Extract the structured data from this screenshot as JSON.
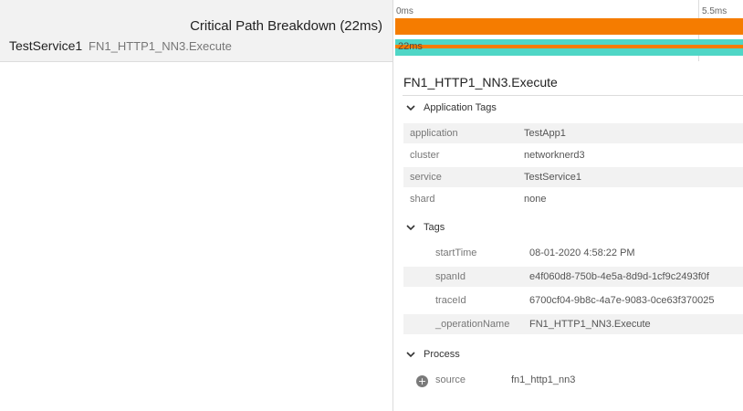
{
  "left_header": {
    "critical_path_title": "Critical Path Breakdown (22ms)",
    "service_name": "TestService1",
    "operation_name": "FN1_HTTP1_NN3.Execute"
  },
  "timeline": {
    "tick_start": "0ms",
    "tick_mid": "5.5ms",
    "span_duration_label": "22ms"
  },
  "detail": {
    "title": "FN1_HTTP1_NN3.Execute",
    "application_tags": {
      "heading": "Application Tags",
      "rows": [
        {
          "key": "application",
          "value": "TestApp1"
        },
        {
          "key": "cluster",
          "value": "networknerd3"
        },
        {
          "key": "service",
          "value": "TestService1"
        },
        {
          "key": "shard",
          "value": "none"
        }
      ]
    },
    "tags": {
      "heading": "Tags",
      "rows": [
        {
          "key": "startTime",
          "value": "08-01-2020 4:58:22 PM"
        },
        {
          "key": "spanId",
          "value": "e4f060d8-750b-4e5a-8d9d-1cf9c2493f0f"
        },
        {
          "key": "traceId",
          "value": "6700cf04-9b8c-4a7e-9083-0ce63f370025"
        },
        {
          "key": "_operationName",
          "value": "FN1_HTTP1_NN3.Execute"
        }
      ]
    },
    "process": {
      "heading": "Process",
      "rows": [
        {
          "key": "source",
          "value": "fn1_http1_nn3"
        }
      ]
    }
  },
  "colors": {
    "orange_bar": "#f57c00",
    "teal_bar": "#4fd6c6"
  },
  "icons": [
    "chevron-down-icon",
    "plus-circle-icon"
  ]
}
